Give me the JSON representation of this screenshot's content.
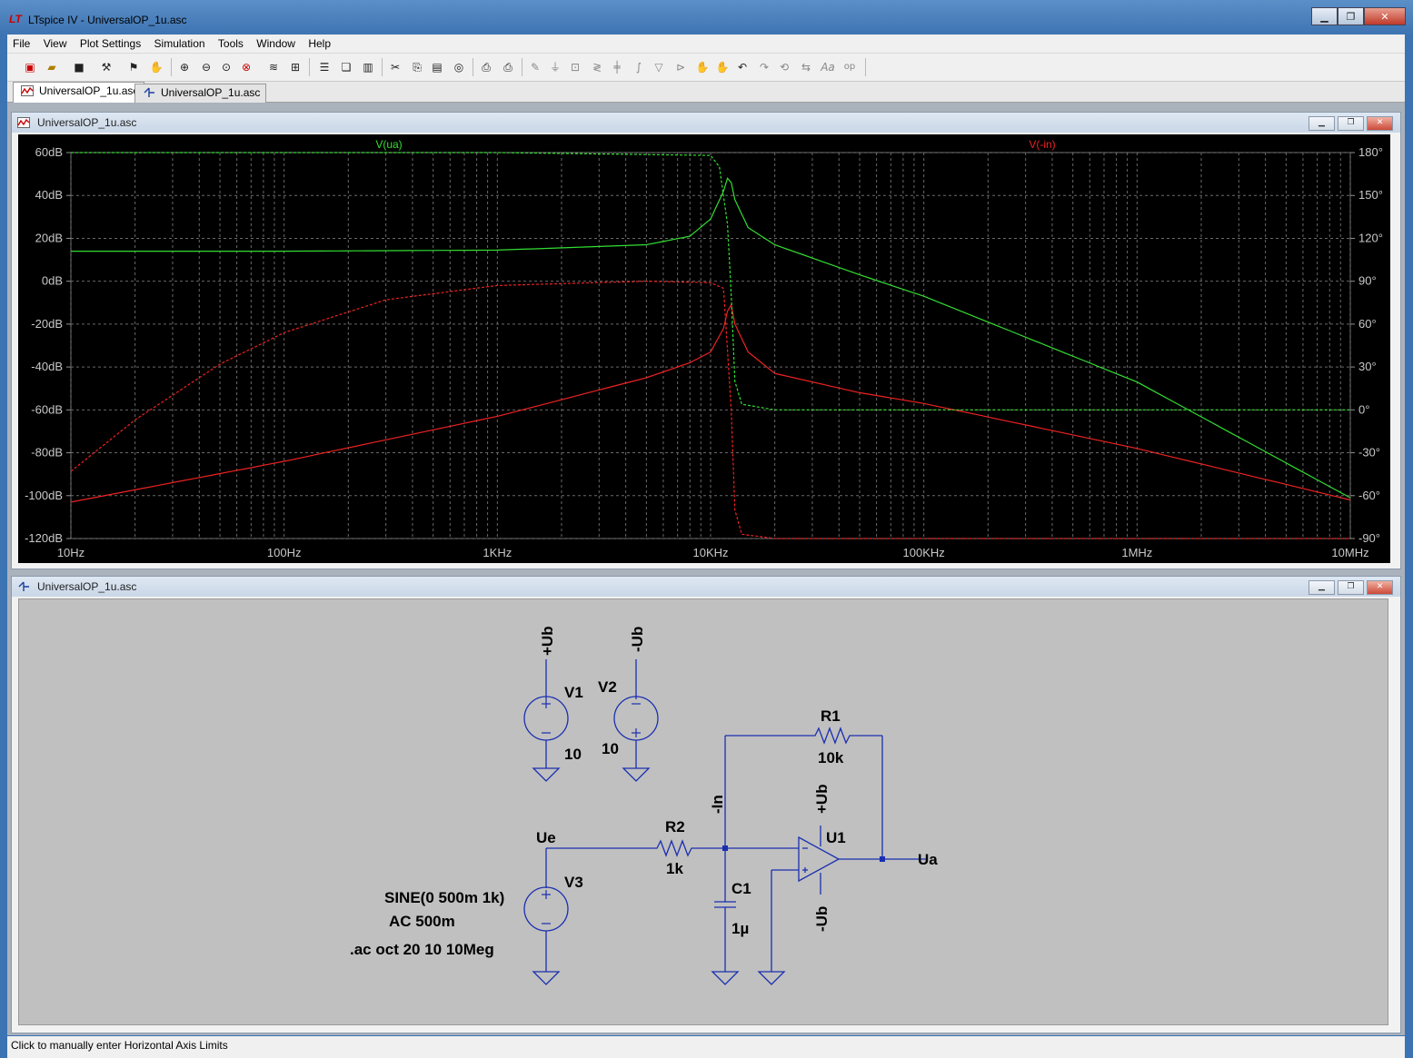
{
  "app": {
    "title": "LTspice IV - UniversalOP_1u.asc",
    "logo": "LT"
  },
  "menu": [
    "File",
    "View",
    "Plot Settings",
    "Simulation",
    "Tools",
    "Window",
    "Help"
  ],
  "tabs": [
    {
      "label": "UniversalOP_1u.asc",
      "icon": "waveform-icon",
      "active": true
    },
    {
      "label": "UniversalOP_1u.asc",
      "icon": "schematic-icon",
      "active": false
    }
  ],
  "plot_window": {
    "title": "UniversalOP_1u.asc",
    "traces": [
      {
        "name": "V(ua)",
        "color": "#33dd33"
      },
      {
        "name": "V(-in)",
        "color": "#ee2222"
      }
    ],
    "y_left_labels": [
      "60dB",
      "40dB",
      "20dB",
      "0dB",
      "-20dB",
      "-40dB",
      "-60dB",
      "-80dB",
      "-100dB",
      "-120dB"
    ],
    "y_right_labels": [
      "180°",
      "150°",
      "120°",
      "90°",
      "60°",
      "30°",
      "0°",
      "-30°",
      "-60°",
      "-90°"
    ],
    "x_labels": [
      "10Hz",
      "100Hz",
      "1KHz",
      "10KHz",
      "100KHz",
      "1MHz",
      "10MHz"
    ]
  },
  "chart_data": {
    "type": "line",
    "title": "",
    "x_scale": "log",
    "xlim": [
      10,
      10000000
    ],
    "ylim_left": [
      -120,
      60
    ],
    "ylim_right": [
      -90,
      180
    ],
    "grid": true,
    "series": [
      {
        "name": "V(ua)",
        "axis": "left",
        "color": "#33dd33",
        "x": [
          10,
          100,
          1000,
          5000,
          8000,
          10000,
          11500,
          12000,
          12500,
          13000,
          15000,
          20000,
          50000,
          100000,
          1000000,
          10000000
        ],
        "y": [
          14,
          14,
          14.5,
          17,
          21,
          29,
          42,
          48,
          46,
          38,
          25,
          17,
          3,
          -7,
          -47,
          -101
        ]
      },
      {
        "name": "V(-in)",
        "axis": "left",
        "color": "#ee2222",
        "x": [
          10,
          100,
          1000,
          5000,
          8000,
          10000,
          11500,
          12000,
          12500,
          13000,
          15000,
          20000,
          50000,
          100000,
          1000000,
          10000000
        ],
        "y": [
          -103,
          -84,
          -63,
          -45,
          -38,
          -33,
          -22,
          -14,
          -11,
          -20,
          -33,
          -43,
          -52,
          -57,
          -78,
          -102
        ]
      },
      {
        "name": "V(ua) phase",
        "axis": "right",
        "color": "#33dd33",
        "dashed": true,
        "x": [
          10,
          1000,
          10000,
          11000,
          12000,
          12500,
          13000,
          14000,
          20000,
          10000000
        ],
        "y": [
          180,
          180,
          178,
          170,
          130,
          80,
          20,
          4,
          0,
          0
        ]
      },
      {
        "name": "V(-in) phase",
        "axis": "right",
        "color": "#ee2222",
        "dashed": true,
        "x": [
          10,
          20,
          50,
          100,
          300,
          1000,
          5000,
          10000,
          11500,
          12500,
          13000,
          14000,
          20000,
          10000000
        ],
        "y": [
          -43,
          -7,
          32,
          54,
          77,
          87,
          90,
          89,
          85,
          0,
          -70,
          -87,
          -90,
          -90
        ]
      }
    ]
  },
  "schematic_window": {
    "title": "UniversalOP_1u.asc",
    "labels": {
      "v1_node": "+Ub",
      "v2_node": "-Ub",
      "v1": "V1",
      "v2": "V2",
      "v1_val": "10",
      "v2_val": "10",
      "r1": "R1",
      "r1_val": "10k",
      "r2": "R2",
      "r2_val": "1k",
      "c1": "C1",
      "c1_val": "1µ",
      "u1": "U1",
      "u1_pos": "+Ub",
      "u1_neg": "-Ub",
      "in_node": "-In",
      "ue": "Ue",
      "ua": "Ua",
      "v3": "V3",
      "v3_sine": "SINE(0 500m 1k)",
      "v3_ac": "AC 500m",
      "directive": ".ac oct 20 10 10Meg"
    }
  },
  "status": "Click to manually enter Horizontal Axis Limits",
  "toolbar_icons": [
    "new-schematic-icon",
    "open-icon",
    "save-icon",
    "control-panel-icon",
    "run-icon",
    "halt-icon",
    "zoom-in-icon",
    "zoom-out-icon",
    "zoom-fit-icon",
    "zoom-cancel-icon",
    "autorange-icon",
    "grid-icon",
    "tile-horizontal-icon",
    "cascade-icon",
    "tile-vertical-icon",
    "cut-icon",
    "copy-icon",
    "paste-icon",
    "find-icon",
    "print-preview-icon",
    "print-icon",
    "wire-icon",
    "ground-icon",
    "label-icon",
    "resistor-icon",
    "capacitor-icon",
    "inductor-icon",
    "diode-icon",
    "component-icon",
    "move-icon",
    "drag-icon",
    "undo-icon",
    "redo-icon",
    "rotate-icon",
    "mirror-icon",
    "text-icon",
    "spice-directive-icon"
  ]
}
